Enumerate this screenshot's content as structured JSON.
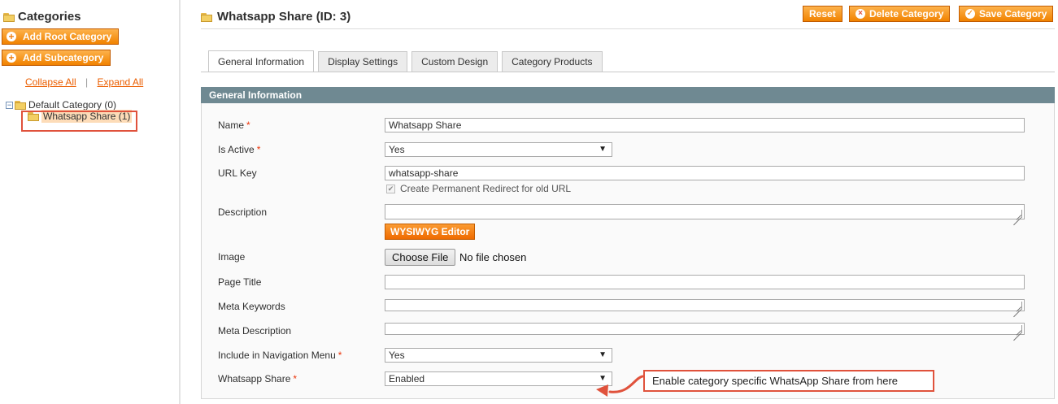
{
  "sidebar": {
    "title": "Categories",
    "add_root_label": "Add Root Category",
    "add_sub_label": "Add Subcategory",
    "collapse_label": "Collapse All",
    "separator": "|",
    "expand_label": "Expand All",
    "tree": {
      "root_label": "Default Category (0)",
      "child_label": "Whatsapp Share (1)"
    }
  },
  "header": {
    "title": "Whatsapp Share (ID: 3)",
    "reset_label": "Reset",
    "delete_label": "Delete Category",
    "save_label": "Save Category"
  },
  "tabs": [
    {
      "label": "General Information",
      "active": true
    },
    {
      "label": "Display Settings",
      "active": false
    },
    {
      "label": "Custom Design",
      "active": false
    },
    {
      "label": "Category Products",
      "active": false
    }
  ],
  "section_title": "General Information",
  "form": {
    "required_mark": "*",
    "name": {
      "label": "Name",
      "value": "Whatsapp Share"
    },
    "is_active": {
      "label": "Is Active",
      "value": "Yes"
    },
    "url_key": {
      "label": "URL Key",
      "value": "whatsapp-share",
      "redirect_label": "Create Permanent Redirect for old URL"
    },
    "description": {
      "label": "Description",
      "value": "",
      "editor_button": "WYSIWYG Editor"
    },
    "image": {
      "label": "Image",
      "button_label": "Choose File",
      "status": "No file chosen"
    },
    "page_title": {
      "label": "Page Title",
      "value": ""
    },
    "meta_keywords": {
      "label": "Meta Keywords",
      "value": ""
    },
    "meta_description": {
      "label": "Meta Description",
      "value": ""
    },
    "include_nav": {
      "label": "Include in Navigation Menu",
      "value": "Yes"
    },
    "whatsapp_share": {
      "label": "Whatsapp Share",
      "value": "Enabled"
    }
  },
  "annotation": {
    "text": "Enable category specific WhatsApp Share from here",
    "color": "#e0523c"
  },
  "colors": {
    "accent": "#f18200",
    "section_head": "#6f8992",
    "link": "#eb5e00",
    "required": "#eb340a"
  }
}
